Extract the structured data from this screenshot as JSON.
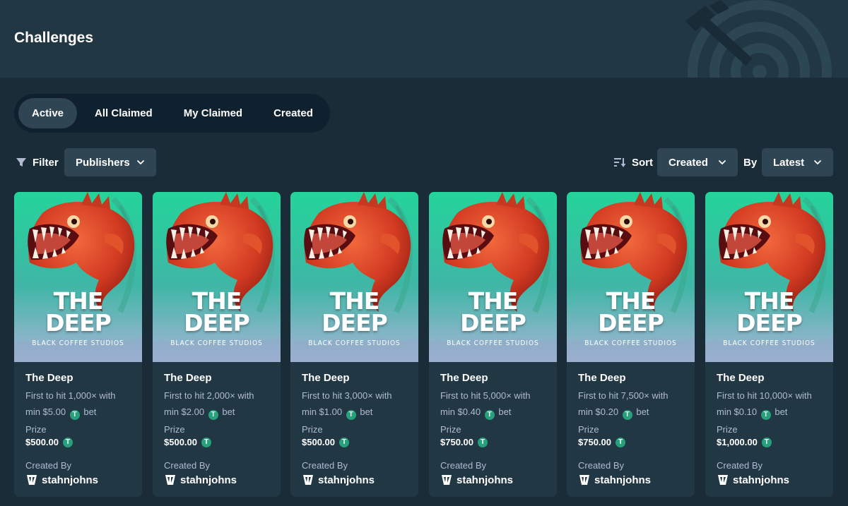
{
  "header": {
    "title": "Challenges"
  },
  "tabs": [
    {
      "label": "Active",
      "active": true
    },
    {
      "label": "All Claimed",
      "active": false
    },
    {
      "label": "My Claimed",
      "active": false
    },
    {
      "label": "Created",
      "active": false
    }
  ],
  "filter": {
    "label": "Filter",
    "publishers": "Publishers"
  },
  "sort": {
    "label": "Sort",
    "value": "Created",
    "by_label": "By",
    "by_value": "Latest"
  },
  "card_labels": {
    "prize": "Prize",
    "created_by": "Created By",
    "bet_suffix": "bet"
  },
  "cards": [
    {
      "game": "The Deep",
      "art_line1": "THE",
      "art_line2": "DEEP",
      "studio": "BLACK COFFEE STUDIOS",
      "desc_line1": "First to hit 1,000× with",
      "desc_line2_prefix": "min $5.00",
      "prize": "$500.00",
      "creator": "stahnjohns"
    },
    {
      "game": "The Deep",
      "art_line1": "THE",
      "art_line2": "DEEP",
      "studio": "BLACK COFFEE STUDIOS",
      "desc_line1": "First to hit 2,000× with",
      "desc_line2_prefix": "min $2.00",
      "prize": "$500.00",
      "creator": "stahnjohns"
    },
    {
      "game": "The Deep",
      "art_line1": "THE",
      "art_line2": "DEEP",
      "studio": "BLACK COFFEE STUDIOS",
      "desc_line1": "First to hit 3,000× with",
      "desc_line2_prefix": "min $1.00",
      "prize": "$500.00",
      "creator": "stahnjohns"
    },
    {
      "game": "The Deep",
      "art_line1": "THE",
      "art_line2": "DEEP",
      "studio": "BLACK COFFEE STUDIOS",
      "desc_line1": "First to hit 5,000× with",
      "desc_line2_prefix": "min $0.40",
      "prize": "$750.00",
      "creator": "stahnjohns"
    },
    {
      "game": "The Deep",
      "art_line1": "THE",
      "art_line2": "DEEP",
      "studio": "BLACK COFFEE STUDIOS",
      "desc_line1": "First to hit 7,500× with",
      "desc_line2_prefix": "min $0.20",
      "prize": "$750.00",
      "creator": "stahnjohns"
    },
    {
      "game": "The Deep",
      "art_line1": "THE",
      "art_line2": "DEEP",
      "studio": "BLACK COFFEE STUDIOS",
      "desc_line1": "First to hit 10,000× with",
      "desc_line2_prefix": "min $0.10",
      "prize": "$1,000.00",
      "creator": "stahnjohns"
    }
  ],
  "icons": {
    "filter": "funnel-icon",
    "sort": "sort-icon",
    "chevron": "chevron-down-icon",
    "currency": "tether-icon",
    "creator_badge": "creator-badge-icon",
    "header_decoration": "target-icon"
  },
  "colors": {
    "page_bg": "#1a2c38",
    "header_bg": "#213743",
    "tabs_bg": "#0f212e",
    "active_tab": "#2f4553",
    "card_bg": "#213743",
    "muted_text": "#b1bad3",
    "tether_green": "#26a17b"
  }
}
